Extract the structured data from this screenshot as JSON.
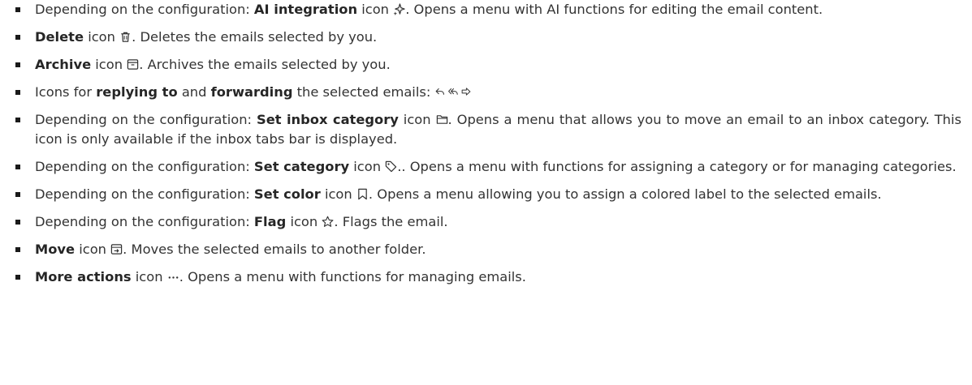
{
  "items": [
    {
      "pre": "Depending on the configuration: ",
      "term": "AI integration",
      "mid": " icon",
      "icon": "ai-sparkle-icon",
      "post": ". Opens a menu with AI functions for editing the email content."
    },
    {
      "pre": "",
      "term": "Delete",
      "mid": " icon",
      "icon": "trash-icon",
      "post": ". Deletes the emails selected by you."
    },
    {
      "pre": "",
      "term": "Archive",
      "mid": " icon",
      "icon": "archive-icon",
      "post": ". Archives the emails selected by you."
    },
    {
      "pre": "Icons for ",
      "term": "replying to",
      "mid2": " and ",
      "term2": "forwarding",
      "post": " the selected emails:",
      "icons": [
        "reply-icon",
        "reply-all-icon",
        "forward-icon"
      ]
    },
    {
      "pre": "Depending on the configuration: ",
      "term": "Set inbox category",
      "mid": " icon",
      "icon": "folder-icon",
      "post": ". Opens a menu that allows you to move an email to an inbox category. This icon is only available if the inbox tabs bar is displayed."
    },
    {
      "pre": "Depending on the configuration: ",
      "term": "Set category",
      "mid": " icon",
      "icon": "tag-icon",
      "post": ".. Opens a menu with functions for assigning a category or for managing categories."
    },
    {
      "pre": "Depending on the configuration: ",
      "term": "Set color",
      "mid": " icon",
      "icon": "bookmark-icon",
      "post": ". Opens a menu allowing you to assign a colored label to the selected emails."
    },
    {
      "pre": "Depending on the configuration: ",
      "term": "Flag",
      "mid": " icon",
      "icon": "star-icon",
      "post": ". Flags the email."
    },
    {
      "pre": "",
      "term": "Move",
      "mid": " icon",
      "icon": "move-folder-icon",
      "post": ". Moves the selected emails to another folder."
    },
    {
      "pre": "",
      "term": "More actions",
      "mid": " icon",
      "icon": "more-dots-icon",
      "post": ". Opens a menu with functions for managing emails."
    }
  ]
}
